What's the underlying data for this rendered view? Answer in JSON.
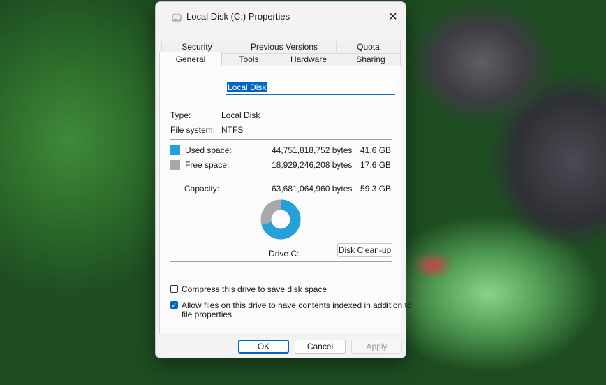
{
  "window": {
    "title": "Local Disk  (C:) Properties",
    "close_glyph": "✕"
  },
  "tabs_row1": [
    {
      "label": "Security"
    },
    {
      "label": "Previous Versions"
    },
    {
      "label": "Quota"
    }
  ],
  "tabs_row2": [
    {
      "label": "General",
      "active": true
    },
    {
      "label": "Tools"
    },
    {
      "label": "Hardware"
    },
    {
      "label": "Sharing"
    }
  ],
  "general": {
    "drive_name": "Local Disk",
    "type_label": "Type:",
    "type_value": "Local Disk",
    "fs_label": "File system:",
    "fs_value": "NTFS",
    "used": {
      "label": "Used space:",
      "bytes": "44,751,818,752 bytes",
      "size": "41.6 GB",
      "color": "#26a0da"
    },
    "free": {
      "label": "Free space:",
      "bytes": "18,929,246,208 bytes",
      "size": "17.6 GB",
      "color": "#a8a8a8"
    },
    "capacity": {
      "label": "Capacity:",
      "bytes": "63,681,064,960 bytes",
      "size": "59.3 GB"
    },
    "used_fraction": 0.703,
    "drive_caption": "Drive C:",
    "cleanup_label": "Disk Clean-up",
    "compress_label": "Compress this drive to save disk space",
    "compress_checked": false,
    "index_label_line1": "Allow files on this drive to have contents indexed in addition to",
    "index_label_line2": "file properties",
    "index_checked": true
  },
  "buttons": {
    "ok": "OK",
    "cancel": "Cancel",
    "apply": "Apply"
  }
}
